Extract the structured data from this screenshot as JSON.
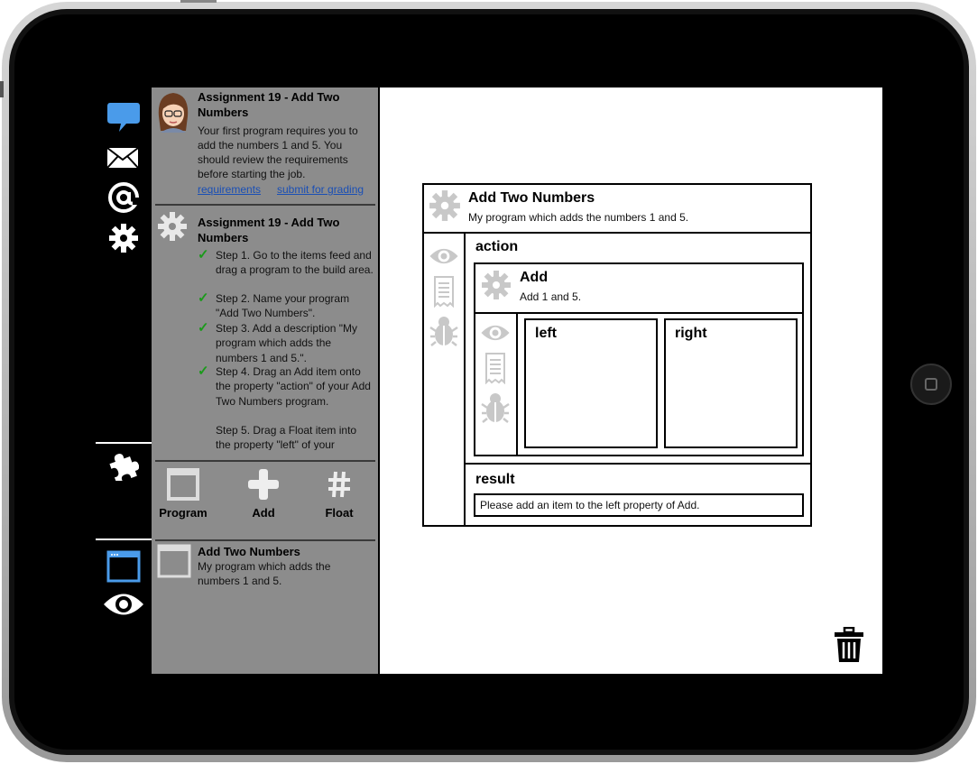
{
  "chat_panel": {
    "title": "Assignment 19 - Add Two Numbers",
    "message": "Your first program requires you to add the numbers 1 and 5. You should review the requirements before starting the job.",
    "links": [
      "requirements",
      "submit for grading"
    ]
  },
  "tasks_panel": {
    "title": "Assignment 19 - Add Two Numbers",
    "steps": [
      {
        "text": "Step 1. Go to the items feed and drag a program to the build area.",
        "done": true
      },
      {
        "text": "Step 2. Name your program \"Add Two Numbers\".",
        "done": true
      },
      {
        "text": "Step 3. Add a description \"My program which adds the numbers 1 and 5.\".",
        "done": true
      },
      {
        "text": "Step 4. Drag an Add item onto the property \"action\" of your Add Two Numbers program.",
        "done": true
      },
      {
        "text": "Step 5. Drag a Float item into the property \"left\" of your",
        "done": false
      }
    ]
  },
  "palette": {
    "items": [
      {
        "label": "Program",
        "icon": "window-icon"
      },
      {
        "label": "Add",
        "icon": "plus-icon"
      },
      {
        "label": "Float",
        "icon": "hash-icon"
      }
    ]
  },
  "program_list": {
    "items": [
      {
        "title": "Add Two Numbers",
        "description": "My program which adds the numbers 1 and 5."
      }
    ]
  },
  "sidebar_icons": [
    "chat-bubble-icon",
    "envelope-icon",
    "at-sign-icon",
    "gear-icon",
    "puzzle-icon",
    "window-icon",
    "eye-icon"
  ],
  "program": {
    "title": "Add Two Numbers",
    "description": "My program which adds the numbers 1 and 5.",
    "action_label": "action",
    "add_item": {
      "title": "Add",
      "description": "Add 1 and 5.",
      "left_label": "left",
      "right_label": "right"
    },
    "result_label": "result",
    "result_value": "Please add an item to the left property of Add."
  },
  "colors": {
    "accent_blue": "#4a9bea",
    "panel_gray": "#8c8c8c",
    "check_green": "#1a9a1a",
    "link_blue": "#1a4fb5"
  }
}
